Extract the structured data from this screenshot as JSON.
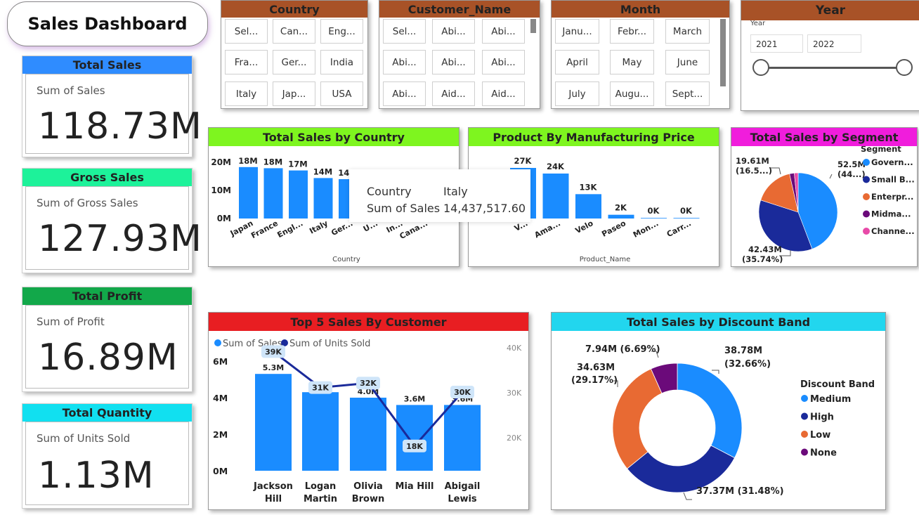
{
  "title": "Sales Dashboard",
  "kpis": [
    {
      "title": "Total Sales",
      "subtitle": "Sum of Sales",
      "value": "118.73M",
      "color": "#2f8cff"
    },
    {
      "title": "Gross Sales",
      "subtitle": "Sum of Gross Sales",
      "value": "127.93M",
      "color": "#1df29a"
    },
    {
      "title": "Total Profit",
      "subtitle": "Sum of Profit",
      "value": "16.89M",
      "color": "#12a84a"
    },
    {
      "title": "Total Quantity",
      "subtitle": "Sum of Units Sold",
      "value": "1.13M",
      "color": "#11e0f0"
    }
  ],
  "slicers": {
    "country": {
      "title": "Country",
      "items": [
        "Sel...",
        "Can...",
        "Eng...",
        "Fra...",
        "Ger...",
        "India",
        "Italy",
        "Jap...",
        "USA"
      ]
    },
    "customer": {
      "title": "Customer_Name",
      "items": [
        "Sel...",
        "Abi...",
        "Abi...",
        "Abi...",
        "Abi...",
        "Abi...",
        "Abi...",
        "Aid...",
        "Aid..."
      ]
    },
    "month": {
      "title": "Month",
      "items": [
        "Janu...",
        "Febr...",
        "March",
        "April",
        "May",
        "June",
        "July",
        "Augu...",
        "Sept..."
      ]
    },
    "year": {
      "title": "Year",
      "label": "Year",
      "from": "2021",
      "to": "2022"
    }
  },
  "colors": {
    "bar_blue": "#1a8cff",
    "slicer_header": "#a85227",
    "header_country_chart": "#7ef51f",
    "header_product_chart": "#7ef51f",
    "header_segment_chart": "#f01ddc",
    "header_customer_chart": "#e81e22",
    "header_discount_chart": "#22d6ee",
    "line_dark": "#1a2a9a"
  },
  "tooltip": {
    "k1": "Country",
    "v1": "Italy",
    "k2": "Sum of Sales",
    "v2": "14,437,517.60"
  },
  "chart_data": [
    {
      "type": "bar",
      "title": "Total Sales by Country",
      "xlabel": "Country",
      "ylabel": "",
      "categories": [
        "Japan",
        "France",
        "Engl...",
        "Italy",
        "Ger...",
        "U...",
        "In...",
        "Cana..."
      ],
      "values": [
        18.3,
        17.9,
        17.1,
        14.4,
        14.0,
        14.0,
        14.0,
        12.0
      ],
      "data_labels": [
        "18M",
        "18M",
        "17M",
        "14M",
        "14M",
        "14M",
        "",
        ""
      ],
      "yticks": [
        "0M",
        "10M",
        "20M"
      ],
      "ylim": [
        0,
        20
      ]
    },
    {
      "type": "bar",
      "title": "Product By Manufacturing Price",
      "xlabel": "Product_Name",
      "ylabel": "",
      "categories": [
        "V...",
        "Ama...",
        "Velo",
        "Paseo",
        "Mon...",
        "Carr..."
      ],
      "values": [
        27,
        24,
        13,
        2,
        0.3,
        0.3
      ],
      "data_labels": [
        "27K",
        "24K",
        "13K",
        "2K",
        "0K",
        "0K"
      ],
      "ylim": [
        0,
        30
      ]
    },
    {
      "type": "pie",
      "title": "Total Sales by Segment",
      "legend_title": "Segment",
      "legend": [
        "Govern...",
        "Small B...",
        "Enterpr...",
        "Midma...",
        "Channe..."
      ],
      "values": [
        52.5,
        42.43,
        19.61,
        2.3,
        1.89
      ],
      "colors": [
        "#1a8cff",
        "#1a2a9a",
        "#e86a33",
        "#6b0a7a",
        "#e84aa8"
      ],
      "labels": [
        {
          "line1": "52.5M",
          "line2": "(44...)"
        },
        {
          "line1": "42.43M",
          "line2": "(35.74%)"
        },
        {
          "line1": "19.61M",
          "line2": "(16.5...)"
        }
      ]
    },
    {
      "type": "bar",
      "title": "Top 5 Sales By Customer",
      "categories": [
        [
          "Jackson",
          "Hill"
        ],
        [
          "Logan",
          "Martin"
        ],
        [
          "Olivia",
          "Brown"
        ],
        [
          "Mia Hill"
        ],
        [
          "Abigail",
          "Lewis"
        ]
      ],
      "series": [
        {
          "name": "Sum of Sales",
          "values": [
            5.3,
            4.3,
            4.0,
            3.6,
            3.6
          ],
          "labels": [
            "5.3M",
            "4.3M",
            "4.0M",
            "3.6M",
            "3.6M"
          ]
        },
        {
          "name": "Sum of Units Sold",
          "values": [
            39,
            31,
            32,
            18,
            30
          ],
          "labels": [
            "39K",
            "31K",
            "32K",
            "18K",
            "30K"
          ]
        }
      ],
      "yticks_left": [
        "0M",
        "2M",
        "4M",
        "6M"
      ],
      "yticks_right": [
        "20K",
        "30K",
        "40K"
      ],
      "ylim_left": [
        0,
        6
      ],
      "ylim_right": [
        15,
        40
      ]
    },
    {
      "type": "pie",
      "title": "Total Sales by Discount Band",
      "legend_title": "Discount Band",
      "legend": [
        "Medium",
        "High",
        "Low",
        "None"
      ],
      "values": [
        38.78,
        37.37,
        34.63,
        7.94
      ],
      "colors": [
        "#1a8cff",
        "#1a2a9a",
        "#e86a33",
        "#6b0a7a"
      ],
      "labels": [
        "38.78M",
        "(32.66%)",
        "37.37M (31.48%)",
        "34.63M",
        "(29.17%)",
        "7.94M (6.69%)"
      ]
    }
  ]
}
